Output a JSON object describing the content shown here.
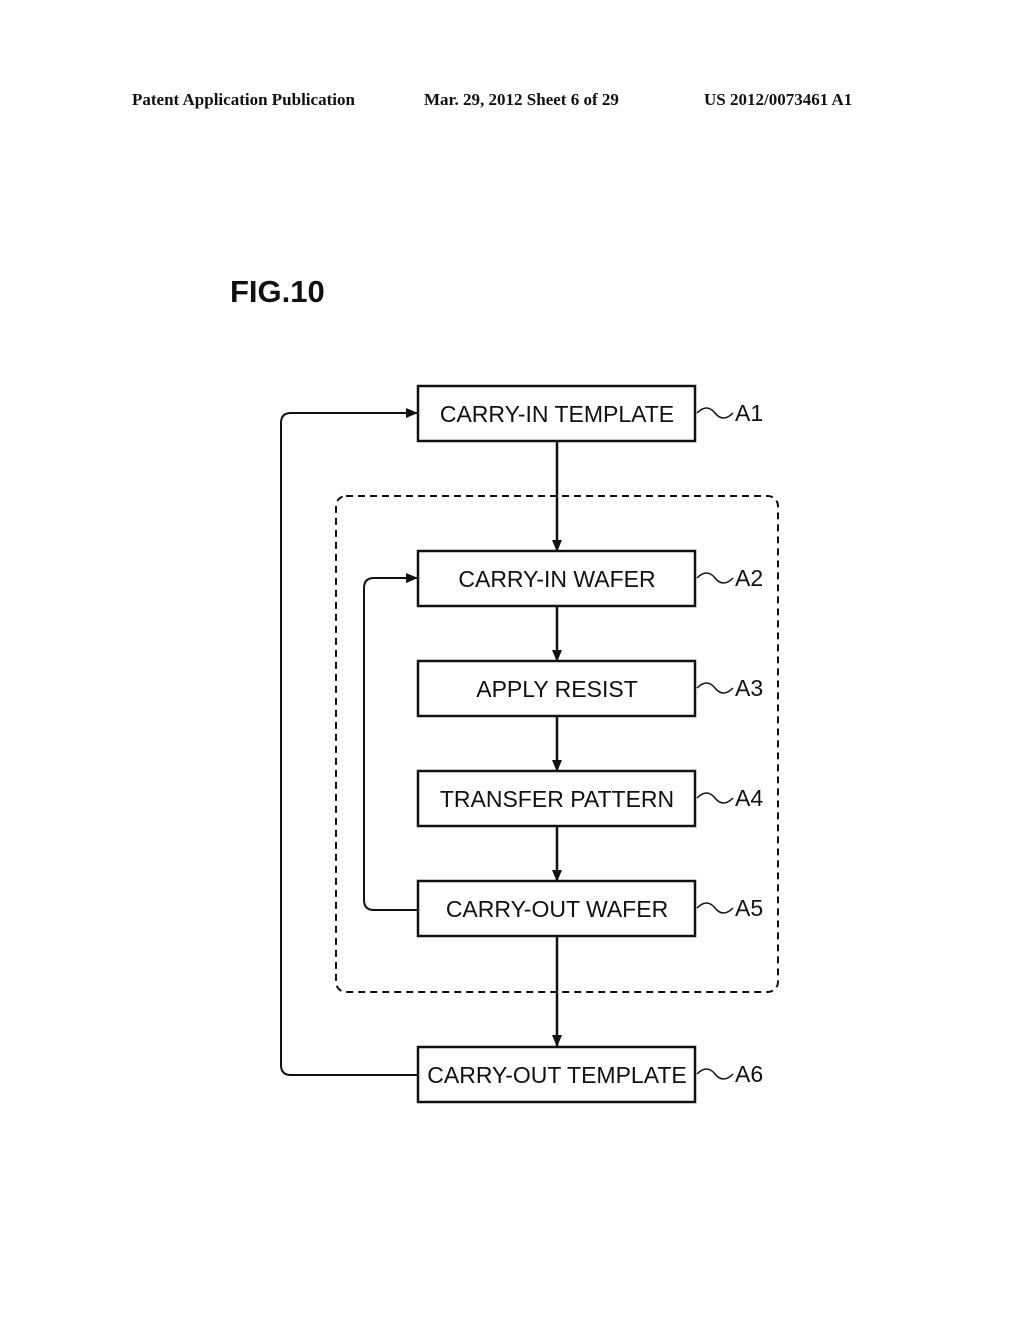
{
  "header": {
    "publication": "Patent Application Publication",
    "date_sheet": "Mar. 29, 2012  Sheet 6 of 29",
    "number": "US 2012/0073461 A1"
  },
  "figure": {
    "title": "FIG.10",
    "steps": [
      {
        "id": "A1",
        "label": "CARRY-IN TEMPLATE"
      },
      {
        "id": "A2",
        "label": "CARRY-IN WAFER"
      },
      {
        "id": "A3",
        "label": "APPLY RESIST"
      },
      {
        "id": "A4",
        "label": "TRANSFER PATTERN"
      },
      {
        "id": "A5",
        "label": "CARRY-OUT WAFER"
      },
      {
        "id": "A6",
        "label": "CARRY-OUT TEMPLATE"
      }
    ],
    "loops": [
      {
        "from": "A5",
        "to": "A2",
        "type": "inner-loop"
      },
      {
        "from": "A6",
        "to": "A1",
        "type": "outer-loop"
      }
    ],
    "group": {
      "steps": [
        "A2",
        "A3",
        "A4",
        "A5"
      ],
      "style": "dashed"
    }
  }
}
